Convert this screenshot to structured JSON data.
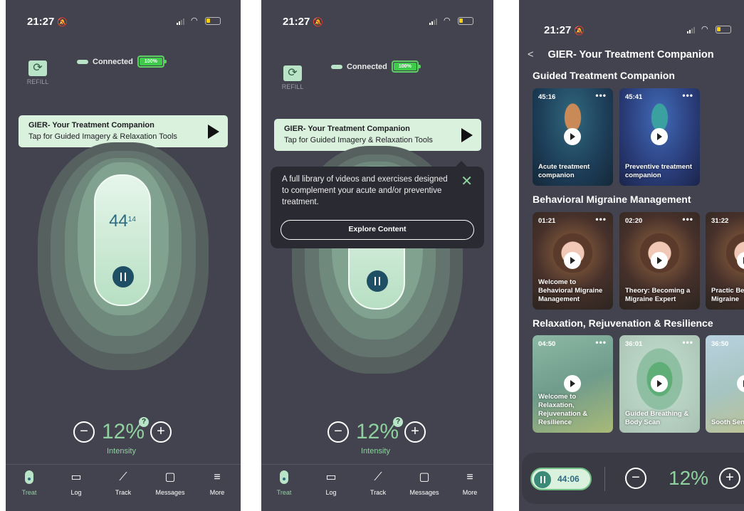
{
  "status": {
    "time": "21:27",
    "bell": "🔕"
  },
  "screen1": {
    "refill_label": "REFILL",
    "connected": "Connected",
    "battery": "100%",
    "banner_title": "GIER- Your Treatment Companion",
    "banner_sub": "Tap for Guided Imagery & Relaxation Tools",
    "timer_main": "44",
    "timer_sec": "14",
    "intensity_value": "12%",
    "intensity_label": "Intensity",
    "minus": "−",
    "plus": "+",
    "help": "?"
  },
  "screen2": {
    "tooltip_text": "A full library of videos and exercises designed to complement your acute and/or preventive treatment.",
    "explore_label": "Explore Content",
    "close": "✕"
  },
  "tabs": [
    {
      "label": "Treat",
      "icon": "treat-icon"
    },
    {
      "label": "Log",
      "icon": "calendar-icon"
    },
    {
      "label": "Track",
      "icon": "chart-icon"
    },
    {
      "label": "Messages",
      "icon": "message-icon"
    },
    {
      "label": "More",
      "icon": "menu-icon"
    }
  ],
  "screen3": {
    "back": "<",
    "header": "GIER- Your Treatment Companion",
    "sections": [
      {
        "title": "Guided Treatment  Companion",
        "cards": [
          {
            "duration": "45:16",
            "title": "Acute treatment companion"
          },
          {
            "duration": "45:41",
            "title": "Preventive treatment companion"
          }
        ]
      },
      {
        "title": "Behavioral Migraine  Management",
        "cards": [
          {
            "duration": "01:21",
            "title": "Welcome to Behavioral Migraine Management"
          },
          {
            "duration": "02:20",
            "title": "Theory: Becoming a Migraine Expert"
          },
          {
            "duration": "31:22",
            "title": "Practic Becoming Migraine"
          }
        ]
      },
      {
        "title": "Relaxation,  Rejuvenation & Resilience",
        "cards": [
          {
            "duration": "04:50",
            "title": "Welcome to Relaxation, Rejuvenation & Resilience"
          },
          {
            "duration": "36:01",
            "title": "Guided Breathing & Body Scan"
          },
          {
            "duration": "36:50",
            "title": "Sooth Sensory S"
          }
        ]
      }
    ],
    "bottom_timer": "44:06",
    "bottom_pct": "12%",
    "dots": "•••"
  },
  "colors": {
    "bg": "#43434f",
    "accent": "#b9e4c7",
    "green_text": "#8fd19e",
    "dark_blue": "#1f4f64"
  }
}
